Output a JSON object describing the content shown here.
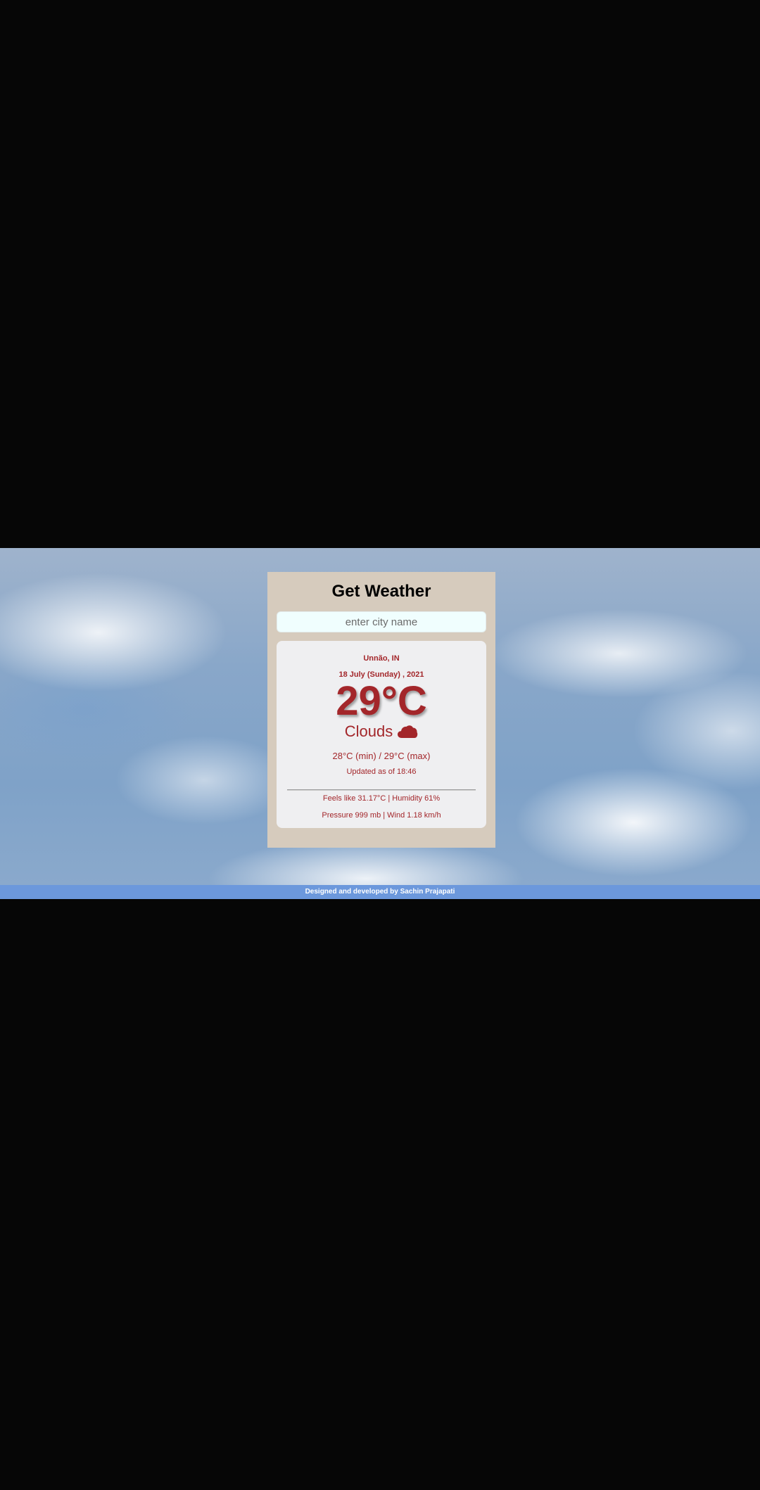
{
  "app": {
    "title": "Get Weather"
  },
  "search": {
    "placeholder": "enter city name",
    "value": ""
  },
  "weather": {
    "city": "Unnão, IN",
    "date": "18 July (Sunday) , 2021",
    "temperature": "29°C",
    "condition": "Clouds",
    "condition_icon": "cloud-icon",
    "min_max": "28°C (min) / 29°C (max)",
    "updated": "Updated as of 18:46",
    "feels_humidity": "Feels like 31.17°C | Humidity 61%",
    "pressure_wind": "Pressure 999 mb | Wind 1.18 km/h"
  },
  "footer": {
    "text": "Designed and developed by Sachin Prajapati"
  },
  "colors": {
    "page_background": "#060606",
    "card_background": "#d6cbbd",
    "search_background": "#f0fefe",
    "result_background": "#efeff1",
    "accent_text": "#a3262a",
    "footer_background": "#6c98dc"
  }
}
